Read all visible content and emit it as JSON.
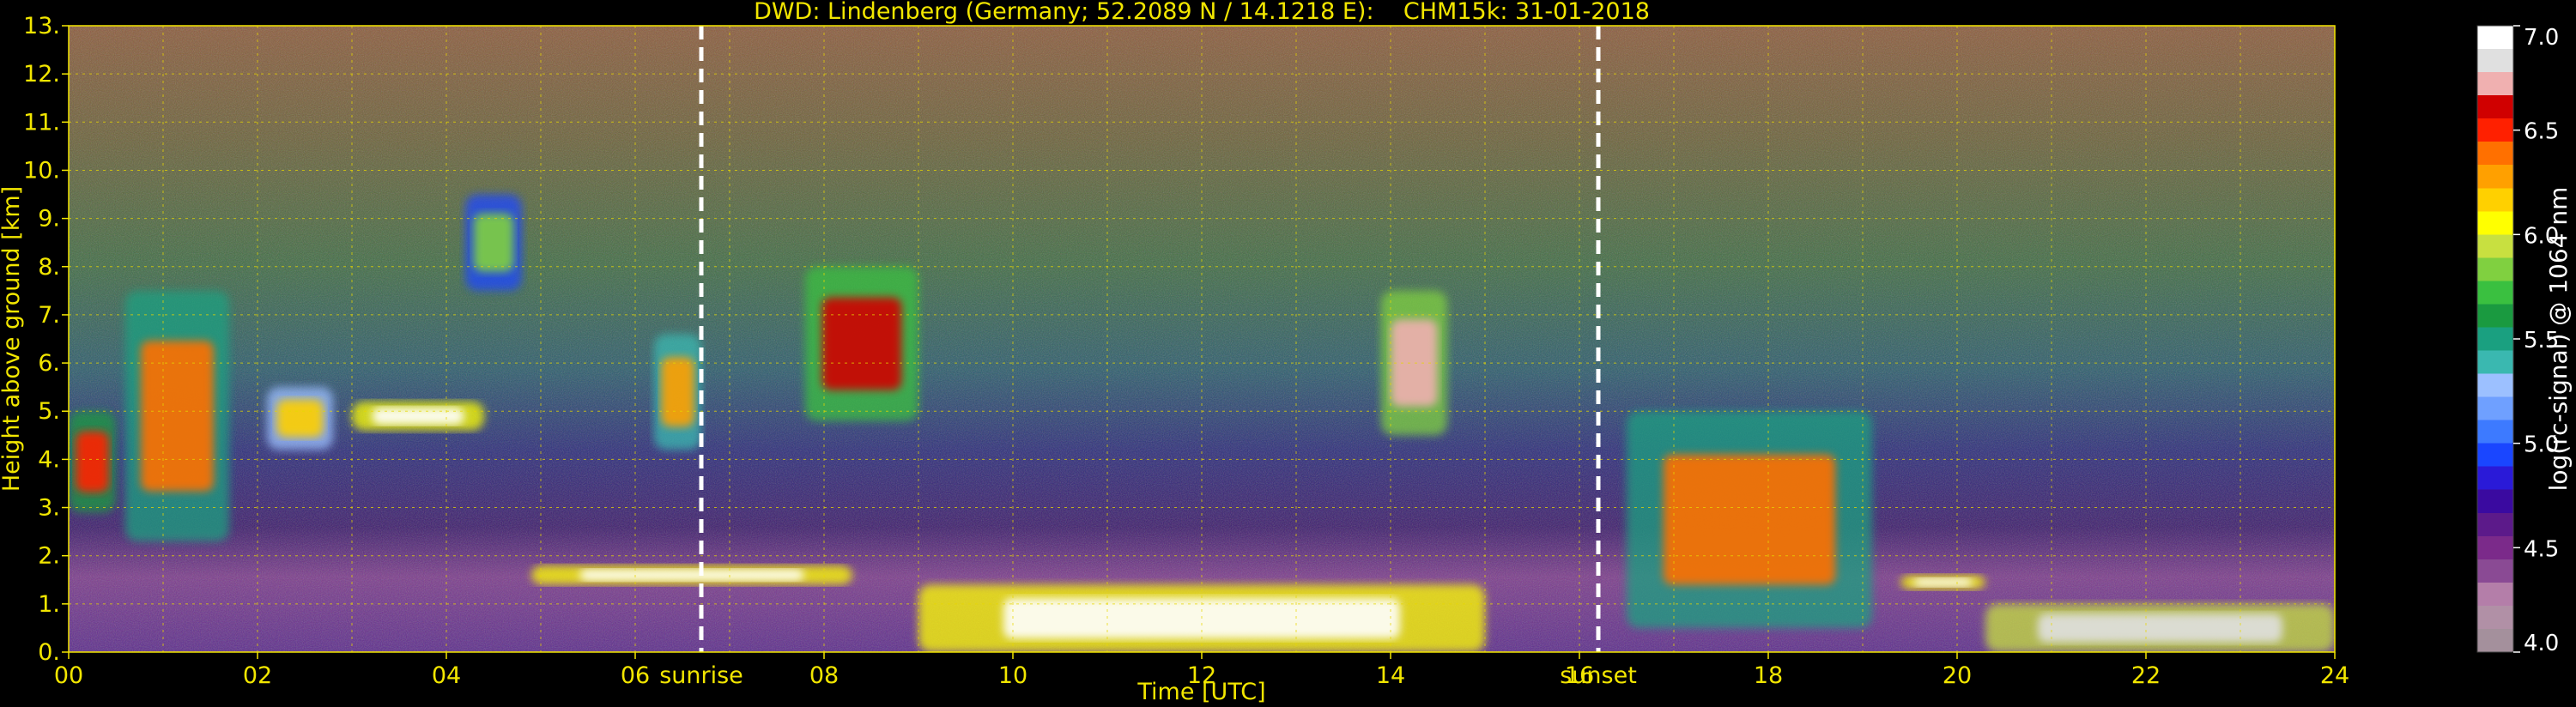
{
  "chart_data": {
    "type": "heatmap",
    "title": "DWD: Lindenberg (Germany; 52.2089 N / 14.1218 E):    CHM15k: 31-01-2018",
    "xlabel": "Time [UTC]",
    "ylabel": "Height above ground [km]",
    "xlim": [
      0,
      24
    ],
    "ylim": [
      0,
      13
    ],
    "xticks": [
      0,
      2,
      4,
      6,
      8,
      10,
      12,
      14,
      16,
      18,
      20,
      22,
      24
    ],
    "xtick_labels": [
      "00",
      "02",
      "04",
      "06",
      "08",
      "10",
      "12",
      "14",
      "16",
      "18",
      "20",
      "22",
      "24"
    ],
    "yticks": [
      0,
      1,
      2,
      3,
      4,
      5,
      6,
      7,
      8,
      9,
      10,
      11,
      12,
      13
    ],
    "ytick_labels": [
      "0.",
      "1.",
      "2.",
      "3.",
      "4.",
      "5.",
      "6.",
      "7.",
      "8.",
      "9.",
      "10.",
      "11.",
      "12.",
      "13."
    ],
    "grid": true,
    "markers": [
      {
        "label": "sunrise",
        "x": 6.7
      },
      {
        "label": "sunset",
        "x": 16.2
      }
    ],
    "colorbar": {
      "label": "log(rc-signal) @ 1064 nm",
      "range": [
        4.0,
        7.0
      ],
      "ticks": [
        4.0,
        4.5,
        5.0,
        5.5,
        6.0,
        6.5,
        7.0
      ],
      "tick_labels": [
        "4.0",
        "4.5",
        "5.0",
        "5.5",
        "6.0",
        "6.5",
        "7.0"
      ],
      "colors": [
        "#a4909c",
        "#b190a6",
        "#b47ea9",
        "#8a4a94",
        "#7b2a8a",
        "#5c1a8a",
        "#3a0aa0",
        "#2a1ad8",
        "#1a46ff",
        "#3d7aff",
        "#6fa0ff",
        "#9cc0ff",
        "#3ab8b0",
        "#1aa080",
        "#1a9a40",
        "#3ac040",
        "#80d040",
        "#c8e040",
        "#ffff00",
        "#ffd000",
        "#ffa000",
        "#ff7000",
        "#ff2000",
        "#d00000",
        "#f0b0b0",
        "#e0e0e0",
        "#ffffff"
      ]
    },
    "cloud_features": [
      {
        "t0": 0.0,
        "t1": 0.5,
        "h0": 2.9,
        "h1": 5.0,
        "level": 6.5
      },
      {
        "t0": 0.6,
        "t1": 1.7,
        "h0": 2.3,
        "h1": 7.5,
        "level": 6.4
      },
      {
        "t0": 2.1,
        "t1": 2.8,
        "h0": 4.2,
        "h1": 5.5,
        "level": 6.2
      },
      {
        "t0": 3.0,
        "t1": 4.4,
        "h0": 4.6,
        "h1": 5.2,
        "level": 6.9
      },
      {
        "t0": 4.2,
        "t1": 4.8,
        "h0": 7.5,
        "h1": 9.5,
        "level": 5.8
      },
      {
        "t0": 6.2,
        "t1": 6.7,
        "h0": 4.2,
        "h1": 6.6,
        "level": 6.3
      },
      {
        "t0": 7.8,
        "t1": 9.0,
        "h0": 4.8,
        "h1": 8.0,
        "level": 6.6
      },
      {
        "t0": 13.9,
        "t1": 14.6,
        "h0": 4.5,
        "h1": 7.5,
        "level": 6.7
      },
      {
        "t0": 16.5,
        "t1": 19.1,
        "h0": 0.5,
        "h1": 5.0,
        "level": 6.4
      },
      {
        "t0": 4.9,
        "t1": 8.3,
        "h0": 1.4,
        "h1": 1.8,
        "level": 6.9
      },
      {
        "t0": 9.0,
        "t1": 15.0,
        "h0": 0.0,
        "h1": 1.4,
        "level": 6.9
      },
      {
        "t0": 19.4,
        "t1": 20.3,
        "h0": 1.3,
        "h1": 1.6,
        "level": 6.9
      },
      {
        "t0": 20.3,
        "t1": 24.0,
        "h0": 0.0,
        "h1": 1.0,
        "level": 6.8
      }
    ]
  }
}
